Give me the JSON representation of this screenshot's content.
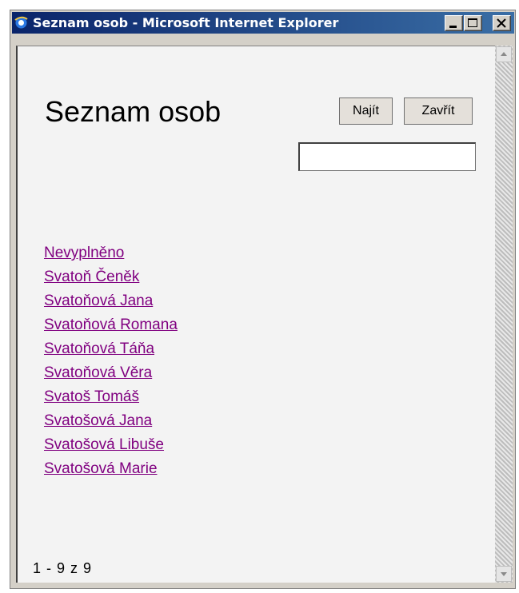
{
  "window": {
    "title": "Seznam osob - Microsoft Internet Explorer",
    "controls": [
      "minimize",
      "maximize",
      "close"
    ]
  },
  "page": {
    "heading": "Seznam osob",
    "find_button": "Najít",
    "close_button": "Zavřít",
    "search_value": "",
    "people": [
      "Nevyplněno",
      "Svatoň Čeněk",
      "Svatoňová Jana",
      "Svatoňová Romana",
      "Svatoňová Táňa",
      "Svatoňová Věra",
      "Svatoš Tomáš",
      "Svatošová Jana",
      "Svatošová Libuše",
      "Svatošová Marie"
    ],
    "pager": "1 - 9 z 9"
  },
  "colors": {
    "titlebar_start": "#0a246a",
    "titlebar_end": "#3a6ea5",
    "link_visited": "#800080",
    "content_bg": "#f3f3f3"
  }
}
